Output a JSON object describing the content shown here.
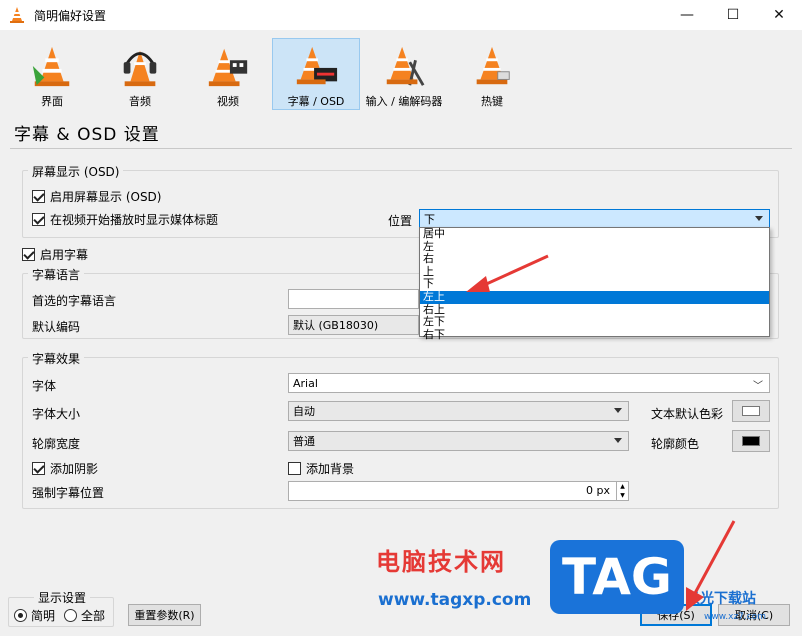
{
  "window": {
    "title": "简明偏好设置",
    "minimize": "—",
    "maximize": "☐",
    "close": "✕"
  },
  "toolbar": [
    {
      "label": "界面",
      "icon": "interface-cone-icon"
    },
    {
      "label": "音频",
      "icon": "audio-headphones-icon"
    },
    {
      "label": "视频",
      "icon": "video-cone-icon"
    },
    {
      "label": "字幕 / OSD",
      "icon": "subtitles-cone-icon"
    },
    {
      "label": "输入 / 编解码器",
      "icon": "codec-cone-icon"
    },
    {
      "label": "热键",
      "icon": "hotkeys-cone-icon"
    }
  ],
  "page_title": "字幕 & OSD 设置",
  "osd": {
    "group_title": "屏幕显示 (OSD)",
    "enable_osd": "启用屏幕显示 (OSD)",
    "show_title": "在视频开始播放时显示媒体标题",
    "position_label": "位置",
    "position_value": "下",
    "position_options": [
      "居中",
      "左",
      "右",
      "上",
      "下",
      "左上",
      "右上",
      "左下",
      "右下"
    ],
    "selected_index": 5
  },
  "subtitles": {
    "enable": "启用字幕",
    "lang_group": "字幕语言",
    "preferred_lang_label": "首选的字幕语言",
    "preferred_lang_value": "",
    "encoding_label": "默认编码",
    "encoding_value": "默认 (GB18030)"
  },
  "effects": {
    "group_title": "字幕效果",
    "font_label": "字体",
    "font_value": "Arial",
    "size_label": "字体大小",
    "size_value": "自动",
    "text_color_label": "文本默认色彩",
    "text_color": "#ffffff",
    "outline_label": "轮廓宽度",
    "outline_value": "普通",
    "outline_color_label": "轮廓颜色",
    "outline_color": "#000000",
    "shadow": "添加阴影",
    "background": "添加背景",
    "force_pos_label": "强制字幕位置",
    "force_pos_value": "0 px"
  },
  "footer": {
    "display_group": "显示设置",
    "simple": "简明",
    "all": "全部",
    "reset": "重置参数(R)",
    "save": "保存(S)",
    "cancel": "取消(C)"
  },
  "watermark": {
    "text": "电脑技术网",
    "url": "www.tagxp.com",
    "tag": "TAG",
    "site": "极光下载站",
    "site_url": "www.xz7.com"
  }
}
